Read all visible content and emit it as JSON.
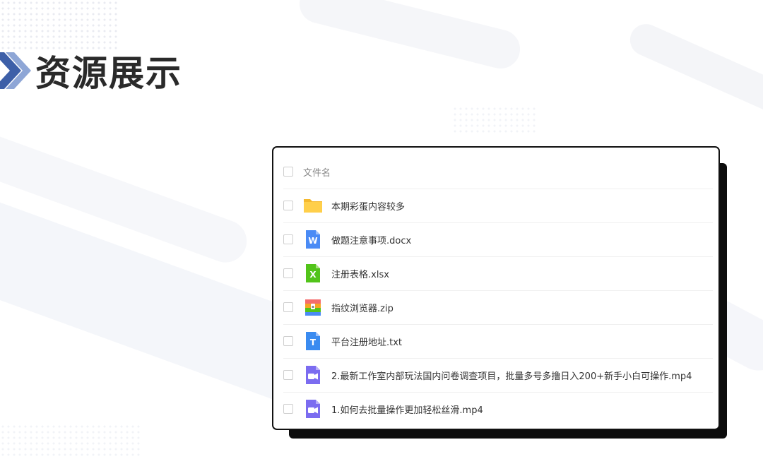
{
  "header": {
    "title": "资源展示"
  },
  "file_list": {
    "column_header": "文件名",
    "items": [
      {
        "name": "本期彩蛋内容较多",
        "icon": "folder-icon",
        "color": "#FFCF4A"
      },
      {
        "name": "做题注意事项.docx",
        "icon": "word-doc-icon",
        "color": "#4A8BF5",
        "glyph": "W"
      },
      {
        "name": "注册表格.xlsx",
        "icon": "excel-sheet-icon",
        "color": "#52C41A",
        "glyph": "X"
      },
      {
        "name": "指纹浏览器.zip",
        "icon": "zip-archive-icon",
        "color": "#F5A623"
      },
      {
        "name": "平台注册地址.txt",
        "icon": "text-file-icon",
        "color": "#3A8BF0",
        "glyph": "T"
      },
      {
        "name": "2.最新工作室内部玩法国内问卷调查项目，批量多号多撸日入200+新手小白可操作.mp4",
        "icon": "video-file-icon",
        "color": "#7B6CF0"
      },
      {
        "name": "1.如何去批量操作更加轻松丝滑.mp4",
        "icon": "video-file-icon",
        "color": "#7B6CF0"
      }
    ]
  }
}
